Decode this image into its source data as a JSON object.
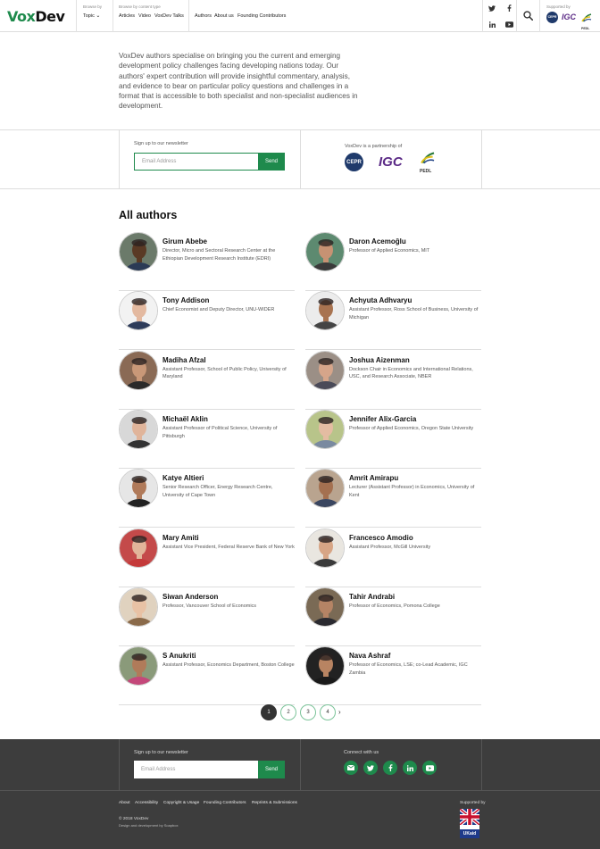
{
  "header": {
    "logo": {
      "part1": "Vox",
      "part2": "Dev"
    },
    "browse_by_label": "Browse by",
    "topic_label": "Topic",
    "content_type_label": "Browse by content type",
    "content_links": [
      "Articles",
      "Video",
      "VoxDev Talks"
    ],
    "other_links": [
      "Authors",
      "About us",
      "Founding Contributors"
    ],
    "social_icons": [
      "twitter-icon",
      "facebook-icon",
      "linkedin-icon",
      "youtube-icon"
    ],
    "search_icon": "search-icon",
    "supported_by_label": "Supported by",
    "supporter_logos": [
      "CEPR",
      "IGC",
      "PEDL"
    ]
  },
  "intro": "VoxDev authors specialise on bringing you the current and emerging development policy challenges facing developing nations today. Our authors' expert contribution will provide insightful commentary, analysis, and evidence to bear on particular policy questions and challenges in a format that is accessible to both specialist and non-specialist audiences in development.",
  "newsletter": {
    "label": "Sign up to our newsletter",
    "placeholder": "Email Address",
    "button": "Send"
  },
  "partnership": {
    "label": "VoxDev is a partnership of",
    "logos": [
      "CEPR",
      "IGC",
      "PEDL"
    ]
  },
  "authors_section": {
    "title": "All authors",
    "authors": [
      {
        "name": "Girum Abebe",
        "role": "Director, Micro and Sectoral Research Center at the Ethiopian Development Research Institute (EDRI)",
        "skin": "#5a3a25",
        "bg": "#6b7a6a",
        "shirt": "#2b3a55"
      },
      {
        "name": "Daron Acemoğlu",
        "role": "Professor of Applied Economics, MIT",
        "skin": "#c79273",
        "bg": "#5d8a70",
        "shirt": "#3a3a3a"
      },
      {
        "name": "Tony Addison",
        "role": "Chief Economist and Deputy Director, UNU-WIDER",
        "skin": "#e3b9a0",
        "bg": "#f2f2f2",
        "shirt": "#2e3c5a"
      },
      {
        "name": "Achyuta Adhvaryu",
        "role": "Assistant Professor, Ross School of Business, University of Michigan",
        "skin": "#a87350",
        "bg": "#ececec",
        "shirt": "#444444"
      },
      {
        "name": "Madiha Afzal",
        "role": "Assistant Professor, School of Public Policy, University of Maryland",
        "skin": "#c99878",
        "bg": "#8a6a55",
        "shirt": "#2a2a2a"
      },
      {
        "name": "Joshua Aizenman",
        "role": "Dockson Chair in Economics and International Relations, USC, and Research Associate, NBER",
        "skin": "#d6a58a",
        "bg": "#9b8f86",
        "shirt": "#4a4a58"
      },
      {
        "name": "Michaël Aklin",
        "role": "Assistant Professor of Political Science, University of Pittsburgh",
        "skin": "#e0b49a",
        "bg": "#d8d8d8",
        "shirt": "#333333"
      },
      {
        "name": "Jennifer Alix-Garcia",
        "role": "Professor of Applied Economics, Oregon State University",
        "skin": "#e4bca2",
        "bg": "#b8c48a",
        "shirt": "#7a8aa0"
      },
      {
        "name": "Katye Altieri",
        "role": "Senior Research Officer, Energy Research Centre, University of Cape Town",
        "skin": "#b07a5a",
        "bg": "#e6e6e6",
        "shirt": "#222222"
      },
      {
        "name": "Amrit Amirapu",
        "role": "Lecturer (Assistant Professor) in Economics, University of Kent",
        "skin": "#a47050",
        "bg": "#b9a48f",
        "shirt": "#3a4660"
      },
      {
        "name": "Mary Amiti",
        "role": "Assistant Vice President, Federal Reserve Bank of New York",
        "skin": "#e2b59a",
        "bg": "#c44a4a",
        "shirt": "#c43a3a"
      },
      {
        "name": "Francesco Amodio",
        "role": "Assistant Professor, McGill University",
        "skin": "#d7a585",
        "bg": "#e9e6e0",
        "shirt": "#3a3a3a"
      },
      {
        "name": "Siwan Anderson",
        "role": "Professor, Vancouver School of Economics",
        "skin": "#e8c2a5",
        "bg": "#e0d2bf",
        "shirt": "#8a6a4a"
      },
      {
        "name": "Tahir Andrabi",
        "role": "Professor of Economics, Pomona College",
        "skin": "#b58465",
        "bg": "#7a6a55",
        "shirt": "#2a2a30"
      },
      {
        "name": "S Anukriti",
        "role": "Assistant Professor, Economics Department, Boston College",
        "skin": "#b07b5a",
        "bg": "#8a9a7a",
        "shirt": "#c4487a"
      },
      {
        "name": "Nava Ashraf",
        "role": "Professor of Economics, LSE; co-Lead Academic, IGC Zambia",
        "skin": "#b88462",
        "bg": "#222222",
        "shirt": "#1a1a1a"
      }
    ]
  },
  "pagination": {
    "pages": [
      "1",
      "2",
      "3",
      "4"
    ],
    "current": "1",
    "next_icon": "chevron-right-icon"
  },
  "footer": {
    "newsletter_label": "Sign up to our newsletter",
    "newsletter_placeholder": "Email Address",
    "newsletter_button": "Send",
    "connect_label": "Connect with us",
    "social_icons": [
      "email-icon",
      "twitter-icon",
      "facebook-icon",
      "linkedin-icon",
      "youtube-icon"
    ],
    "links": [
      "About",
      "Accessibility",
      "Copyright & Usage",
      "Founding Contributors",
      "Reprints & Submissions"
    ],
    "copyright": "© 2018 VoxDev",
    "credit": "Design and development by Soapbox",
    "supported_by_label": "Supported by",
    "supporter_logo_text": "UKaid"
  },
  "colors": {
    "brand_green": "#1e8a4c",
    "footer_bg": "#3d3d3d",
    "igc_purple": "#5b2a86",
    "cepr_navy": "#1f3a6b"
  }
}
